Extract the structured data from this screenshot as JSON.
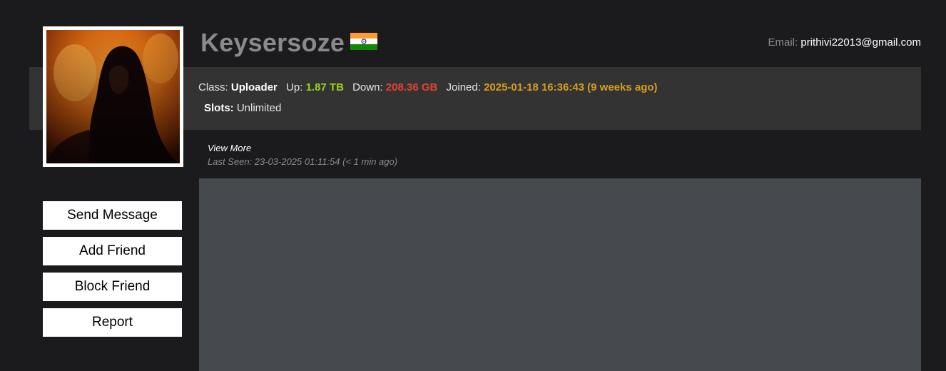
{
  "profile": {
    "username": "Keysersoze",
    "flag_icon": "india-flag-icon",
    "email_label": "Email:",
    "email": "prithivi22013@gmail.com",
    "avatar_icon": "user-avatar-image"
  },
  "stats": {
    "class_label": "Class:",
    "class_value": "Uploader",
    "up_label": "Up:",
    "up_value": "1.87 TB",
    "down_label": "Down:",
    "down_value": "208.36 GB",
    "joined_label": "Joined:",
    "joined_value": "2025-01-18 16:36:43 (9 weeks ago)",
    "slots_label": "Slots:",
    "slots_value": "Unlimited"
  },
  "activity": {
    "view_more": "View More",
    "last_seen": "Last Seen: 23-03-2025 01:11:54 (< 1 min ago)"
  },
  "actions": {
    "send_message": "Send Message",
    "add_friend": "Add Friend",
    "block_friend": "Block Friend",
    "report": "Report"
  },
  "colors": {
    "background": "#1b1b1d",
    "band": "#333334",
    "panel": "#46494d",
    "up": "#9bd21b",
    "down": "#e24235",
    "joined": "#d59e1a",
    "username": "#8a8a8a"
  }
}
